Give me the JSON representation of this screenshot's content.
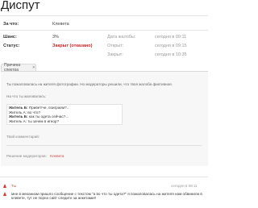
{
  "header": {
    "title": "Диспут"
  },
  "fields": {
    "about_label": "За что:",
    "about_value": "Клевета",
    "chance_label": "Шанс:",
    "chance_value": "3%",
    "status_label": "Статус:",
    "status_value": "Закрыт (отказано)"
  },
  "meta": {
    "filed_label": "Дата жалобы:",
    "filed_value": "сегодня в 09:11",
    "opened_label": "Открыт:",
    "opened_value": "сегодня в 09:15",
    "closed_label": "Закрыт:",
    "closed_value": "сегодня в 10:35"
  },
  "tab": {
    "label": "Причина спектра",
    "close_glyph": "✕"
  },
  "panel": {
    "complaint_text": "Ты пожаловалась на жителя фотографии. Но модераторы решили, что твоя жалоба фиктивная.",
    "heading": "На что ты жаловалась:",
    "lines": [
      {
        "who": "Житель Б:",
        "text": "Привет!че, поиграем?.."
      },
      {
        "who": "",
        "text": "Житель А: во что?"
      },
      {
        "who": "Житель Б:",
        "text": "как ты одета сейчас?..."
      },
      {
        "who": "",
        "text": "Житель А: ты зачем в игнор?"
      }
    ],
    "comment_label": "Твой комментарий:",
    "decision_label": "Решение модераторов:",
    "decision_value": "Клевета"
  },
  "footer": {
    "author": "Ты",
    "author_time": "сегодня в 09:11",
    "message": "мне в механизм пришло сообщение с текстом \"а во что ты одета?\" я пожаловалась на жителя нам обвинили в клевете, тут не порно сайт следите за анкетами!!"
  }
}
